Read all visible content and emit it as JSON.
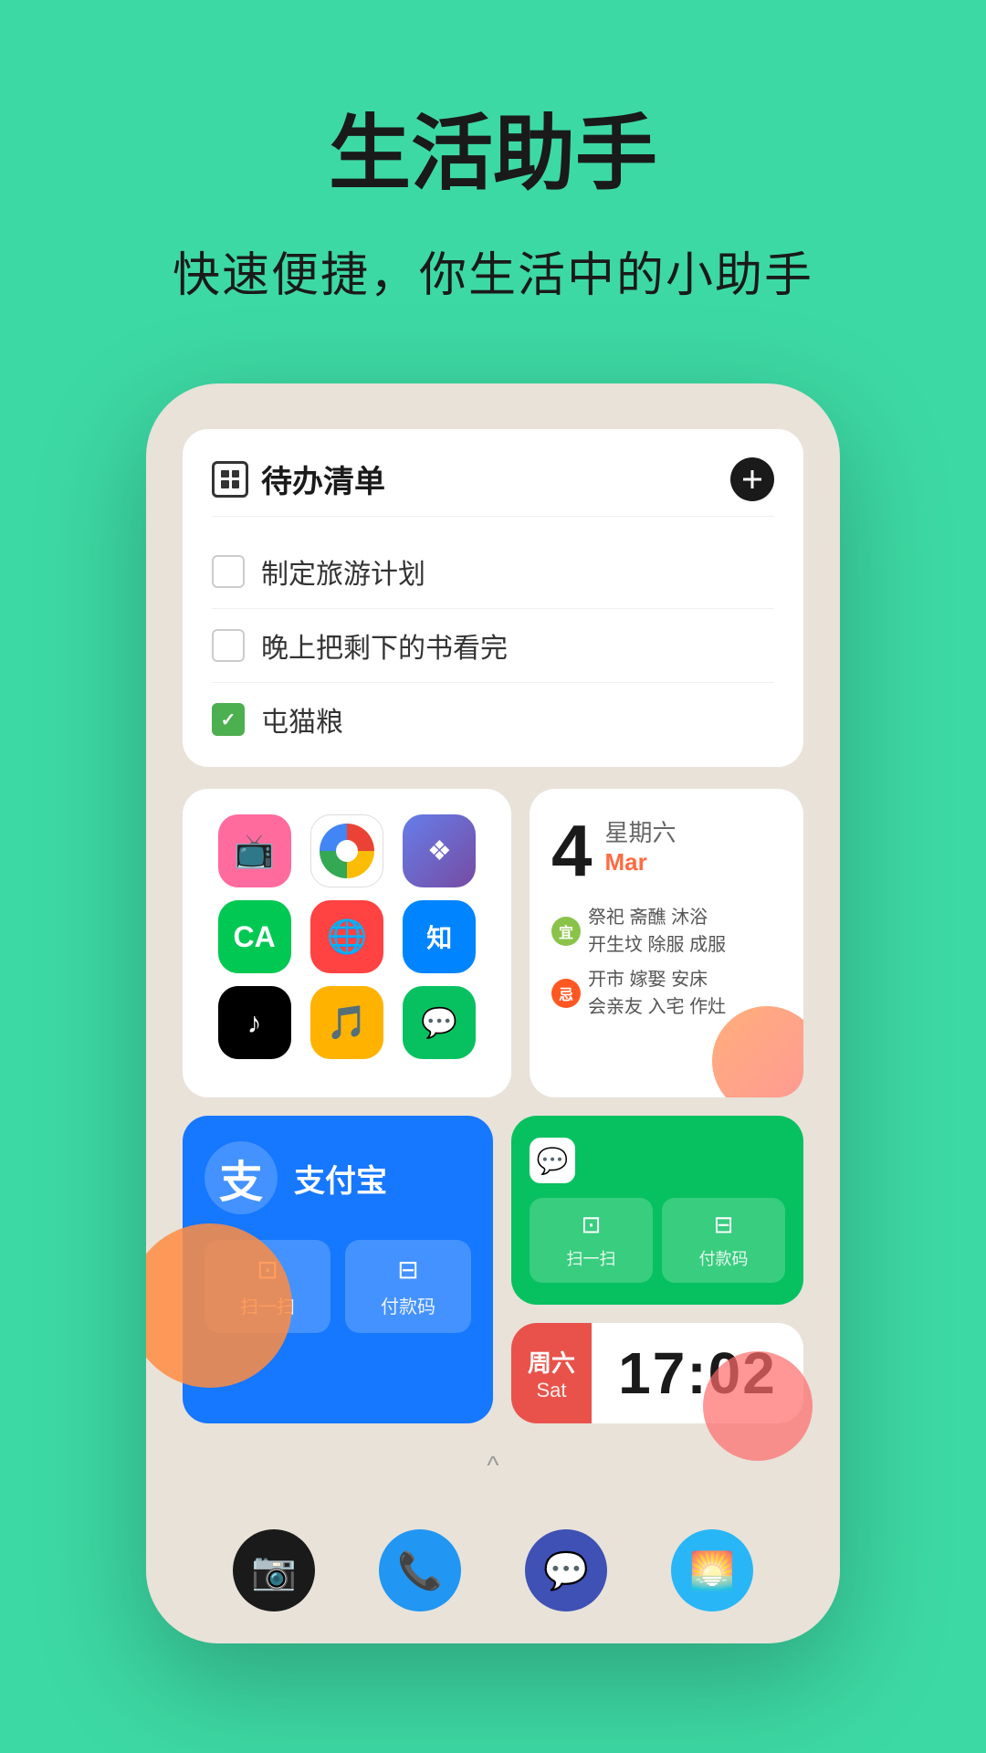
{
  "header": {
    "title": "生活助手",
    "subtitle": "快速便捷，你生活中的小助手"
  },
  "todo_widget": {
    "title": "待办清单",
    "add_button_label": "+",
    "items": [
      {
        "text": "制定旅游计划",
        "checked": false
      },
      {
        "text": "晚上把剩下的书看完",
        "checked": false
      },
      {
        "text": "屯猫粮",
        "checked": true
      }
    ]
  },
  "calendar_widget": {
    "date_number": "4",
    "weekday": "星期六",
    "month": "Mar",
    "yi_label": "宜",
    "yi_items": "祭祀 斋醮 沐浴\n开生坟 除服 成服",
    "ji_label": "忌",
    "ji_items": "开市 嫁娶 安床\n会亲友 入宅 作灶"
  },
  "alipay_widget": {
    "logo_char": "支",
    "name": "支付宝",
    "actions": [
      {
        "icon": "⊡",
        "label": "扫一扫"
      },
      {
        "icon": "⊡",
        "label": "付款码"
      }
    ]
  },
  "wechat_widget": {
    "actions": [
      {
        "label": "扫一扫"
      },
      {
        "label": "付款码"
      }
    ]
  },
  "clock_widget": {
    "weekday_cn": "周六",
    "weekday_en": "Sat",
    "time": "17:02"
  },
  "bottom_dock": {
    "icons": [
      {
        "name": "camera",
        "label": "相机"
      },
      {
        "name": "phone",
        "label": "电话"
      },
      {
        "name": "message",
        "label": "短信"
      },
      {
        "name": "gallery",
        "label": "相册"
      }
    ]
  },
  "colors": {
    "bg": "#3DD9A4",
    "alipay_blue": "#1677FF",
    "wechat_green": "#07C160",
    "clock_red": "#E8524A"
  }
}
